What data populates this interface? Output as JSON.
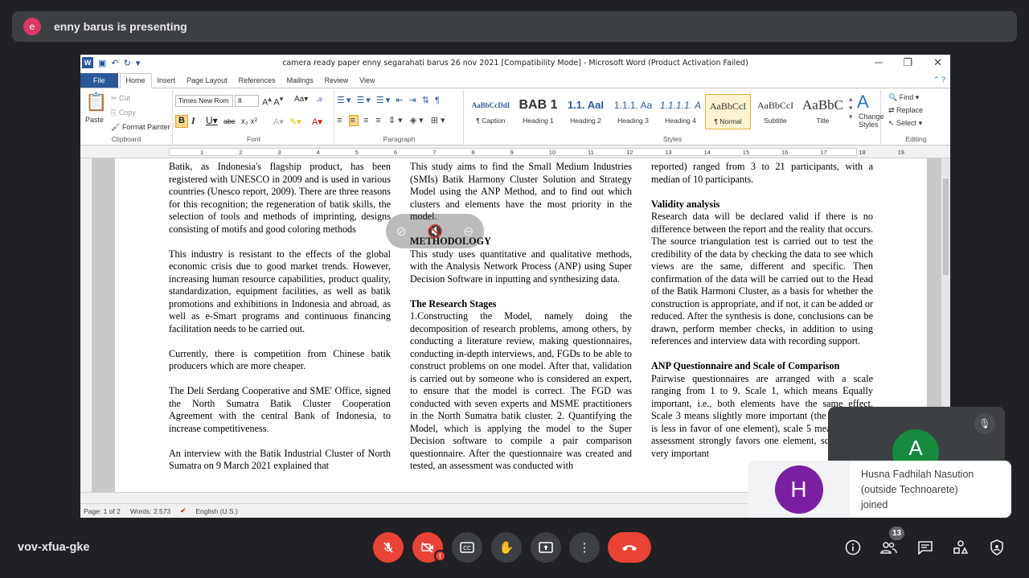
{
  "presenter": {
    "initial": "e",
    "text": "enny barus is presenting"
  },
  "word": {
    "title": "camera ready paper enny segarahati barus 26 nov 2021 [Compatibility Mode]  -  Microsoft Word (Product Activation Failed)",
    "tabs": [
      "File",
      "Home",
      "Insert",
      "Page Layout",
      "References",
      "Mailings",
      "Review",
      "View"
    ],
    "clipboard": {
      "paste": "Paste",
      "cut": "Cut",
      "copy": "Copy",
      "format_painter": "Format Painter",
      "label": "Clipboard"
    },
    "font": {
      "name": "Times New Rom",
      "size": "8",
      "label": "Font"
    },
    "paragraph": {
      "label": "Paragraph"
    },
    "styles": {
      "label": "Styles",
      "items": [
        {
          "sample": "AaBbCcDdI",
          "name": "¶ Caption"
        },
        {
          "sample": "BAB 1",
          "name": "Heading 1"
        },
        {
          "sample": "1.1. AaI",
          "name": "Heading 2"
        },
        {
          "sample": "1.1.1. Aa",
          "name": "Heading 3"
        },
        {
          "sample": "1.1.1.1. A",
          "name": "Heading 4"
        },
        {
          "sample": "AaBbCcI",
          "name": "¶ Normal"
        },
        {
          "sample": "AaBbCcI",
          "name": "Subtitle"
        },
        {
          "sample": "AaBbC",
          "name": "Title"
        }
      ],
      "change": "Change Styles"
    },
    "editing": {
      "find": "Find",
      "replace": "Replace",
      "select": "Select",
      "label": "Editing"
    },
    "ruler_marks": [
      "1",
      "2",
      "3",
      "4",
      "5",
      "6",
      "7",
      "8",
      "9",
      "10",
      "11",
      "12",
      "13",
      "14",
      "15",
      "16",
      "17",
      "18",
      "19"
    ],
    "status": {
      "page": "Page: 1 of 2",
      "words": "Words: 2.573",
      "lang": "English (U.S.)"
    },
    "doc": {
      "col1": [
        "Batik, as Indonesia's flagship product, has been registered with UNESCO in 2009 and is used in various countries (Unesco report, 2009). There are three reasons for this recognition; the regeneration of batik skills, the selection of tools and methods of imprinting, designs consisting of motifs and good coloring methods",
        "This industry is resistant to the effects of the global economic crisis due to good market trends. However, increasing human resource capabilities, product quality, standardization, equipment facilities, as well as batik promotions and exhibitions in Indonesia and abroad, as well as e-Smart programs and continuous financing facilitation needs to be carried out.",
        "Currently, there is competition from Chinese batik producers which are more cheaper.",
        "The Deli Serdang Cooperative and SME' Office, signed the North Sumatra Batik Cluster Cooperation Agreement with the central Bank of Indonesia, to increase competitiveness.",
        "An interview with the Batik Industrial Cluster of North Sumatra on 9 March 2021 explained that"
      ],
      "col2_p1": "This study aims to find the Small Medium Industries (SMIs) Batik Harmony Cluster Solution and Strategy  Model using the ANP Method, and to find out which clusters and elements have the most priority in the model.",
      "col2_h1": "METHODOLOGY",
      "col2_p2": "This study uses quantitative and qualitative methods, with the Analysis Network Process (ANP) using Super Decision Software in inputting and synthesizing data.",
      "col2_h2": "The Research Stages",
      "col2_p3": "1.Constructing the Model, namely doing the decomposition of research problems, among others, by conducting a literature review, making questionnaires, conducting in-depth interviews, and, FGDs to be able to construct problems on one model. After that, validation is carried out by someone who is considered an expert, to ensure that the model is correct. The FGD was conducted with seven experts and MSME practitioners in the North Sumatra batik cluster. 2. Quantifying the Model, which is applying the model to the Super Decision software to compile a pair comparison questionnaire. After the questionnaire was created and tested, an assessment was conducted with",
      "col3_p1": "reported) ranged from 3 to 21 participants, with a median of 10 participants.",
      "col3_h1": "Validity analysis",
      "col3_p2": "Research data will be declared valid if there is no difference between the report and the reality that occurs. The source triangulation test is carried out to test the credibility of the data by checking the data to see which views are the same, different and specific. Then confirmation of the data will be carried out to the Head of the Batik Harmoni Cluster, as a basis for whether the construction is appropriate, and if not, it can be added or reduced. After the synthesis is done, conclusions can be drawn, perform member checks, in addition to using references and interview data with recording support.",
      "col3_h2": "ANP Questionnaire and Scale of Comparison",
      "col3_p3": "Pairwise questionnaires are arranged with a scale ranging from 1 to 9. Scale 1, which means Equally important, i.e., both elements have the same effect. Scale 3 means slightly more important (the assessment is less in favor of one element), scale 5 means that the assessment strongly favors one element, scale of 7 is very important"
    }
  },
  "participant_tile": {
    "initial": "A"
  },
  "toast": {
    "initial": "H",
    "line1": "Husna Fadhilah Nasution",
    "line2": "(outside Technoarete)",
    "line3": "joined"
  },
  "meeting_code": "vov-xfua-gke",
  "participants_count": "13",
  "colors": {
    "meet_bg": "#202124",
    "red": "#ea4335",
    "word_blue": "#2b579a",
    "tile_avatar": "#168a3f",
    "toast_avatar": "#7b1fa2"
  }
}
